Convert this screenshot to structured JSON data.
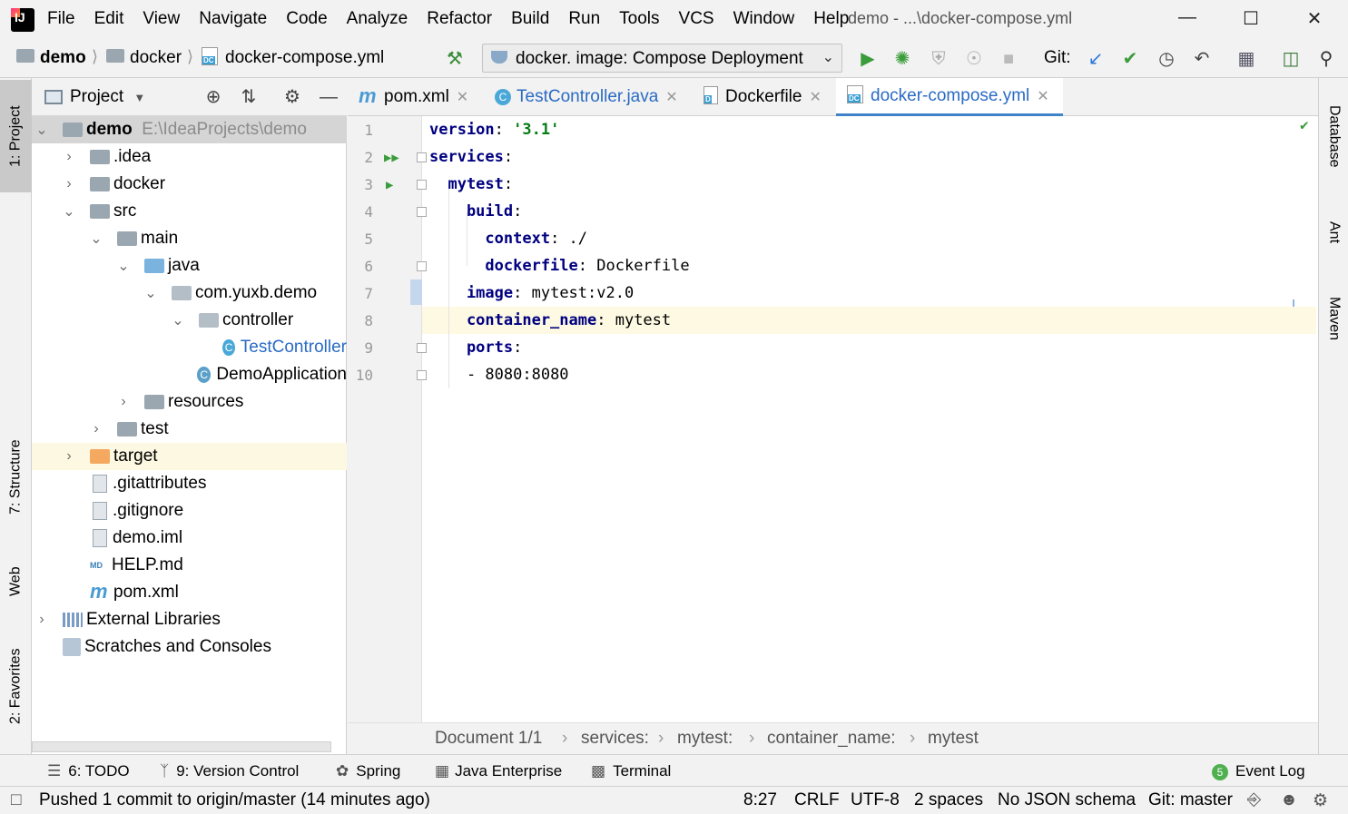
{
  "menubar": {
    "items": [
      "File",
      "Edit",
      "View",
      "Navigate",
      "Code",
      "Analyze",
      "Refactor",
      "Build",
      "Run",
      "Tools",
      "VCS",
      "Window",
      "Help"
    ],
    "window_title": "demo - ...\\docker-compose.yml"
  },
  "navbar": {
    "crumbs": [
      "demo",
      "docker",
      "docker-compose.yml"
    ],
    "run_config": "docker.  image: Compose Deployment",
    "git_label": "Git:"
  },
  "left_strip": {
    "project": "1: Project",
    "structure": "7: Structure",
    "web": "Web",
    "favorites": "2: Favorites"
  },
  "right_strip": {
    "database": "Database",
    "ant": "Ant",
    "maven": "Maven"
  },
  "project": {
    "title": "Project",
    "tree": [
      {
        "label": "demo",
        "path": "E:\\IdeaProjects\\demo"
      },
      {
        "label": ".idea"
      },
      {
        "label": "docker"
      },
      {
        "label": "src"
      },
      {
        "label": "main"
      },
      {
        "label": "java"
      },
      {
        "label": "com.yuxb.demo"
      },
      {
        "label": "controller"
      },
      {
        "label": "TestController"
      },
      {
        "label": "DemoApplication"
      },
      {
        "label": "resources"
      },
      {
        "label": "test"
      },
      {
        "label": "target"
      },
      {
        "label": ".gitattributes"
      },
      {
        "label": ".gitignore"
      },
      {
        "label": "demo.iml"
      },
      {
        "label": "HELP.md"
      },
      {
        "label": "pom.xml"
      },
      {
        "label": "External Libraries"
      },
      {
        "label": "Scratches and Consoles"
      }
    ]
  },
  "tabs": [
    {
      "label": "pom.xml"
    },
    {
      "label": "TestController.java"
    },
    {
      "label": "Dockerfile"
    },
    {
      "label": "docker-compose.yml"
    }
  ],
  "editor": {
    "lines": [
      {
        "n": "1",
        "key": "version",
        "sep": ": ",
        "val": "'3.1'"
      },
      {
        "n": "2",
        "key": "services",
        "sep": ":",
        "val": ""
      },
      {
        "n": "3",
        "key": "  mytest",
        "sep": ":",
        "val": ""
      },
      {
        "n": "4",
        "key": "    build",
        "sep": ":",
        "val": ""
      },
      {
        "n": "5",
        "key": "      context",
        "sep": ": ",
        "val": "./"
      },
      {
        "n": "6",
        "key": "      dockerfile",
        "sep": ": ",
        "val": "Dockerfile"
      },
      {
        "n": "7",
        "key": "    image",
        "sep": ": ",
        "val": "mytest:v2.0"
      },
      {
        "n": "8",
        "key": "    container_name",
        "sep": ": ",
        "val": "mytest"
      },
      {
        "n": "9",
        "key": "    ports",
        "sep": ":",
        "val": ""
      },
      {
        "n": "10",
        "key": "",
        "sep": "    - ",
        "val": "8080:8080"
      }
    ]
  },
  "crumbbar": {
    "items": [
      "Document 1/1",
      "services:",
      "mytest:",
      "container_name:",
      "mytest"
    ]
  },
  "bottom_tabs": {
    "todo": "6: TODO",
    "vcs": "9: Version Control",
    "spring": "Spring",
    "java_ent": "Java Enterprise",
    "terminal": "Terminal",
    "event_log": "Event Log",
    "event_count": "5"
  },
  "status": {
    "message": "Pushed 1 commit to origin/master (14 minutes ago)",
    "position": "8:27",
    "line_sep": "CRLF",
    "encoding": "UTF-8",
    "indent": "2 spaces",
    "schema": "No JSON schema",
    "git": "Git: master"
  }
}
